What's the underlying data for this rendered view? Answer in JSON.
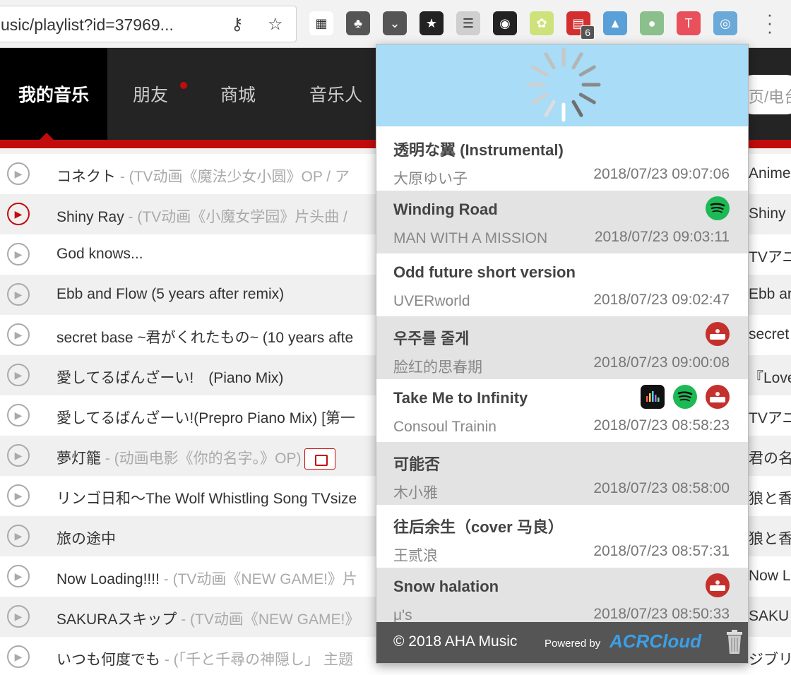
{
  "browser": {
    "url": "usic/playlist?id=37969...",
    "extensions": [
      {
        "name": "qr-code-icon",
        "color": "#ffffff"
      },
      {
        "name": "evernote-icon",
        "color": "#555555"
      },
      {
        "name": "pocket-icon",
        "color": "#555555"
      },
      {
        "name": "bookmark-star-icon",
        "color": "#222222"
      },
      {
        "name": "reader-icon",
        "color": "#cfcfcf"
      },
      {
        "name": "speedometer-icon",
        "color": "#222222"
      },
      {
        "name": "plant-icon",
        "color": "#cde27a"
      },
      {
        "name": "calendar-icon",
        "color": "#d32f2f",
        "badge": "6"
      },
      {
        "name": "stats-icon",
        "color": "#5aa0d8"
      },
      {
        "name": "circle-icon",
        "color": "#8bbf8b"
      },
      {
        "name": "tapermonkey-icon",
        "color": "#e8505b"
      },
      {
        "name": "aha-music-icon",
        "color": "#6aa9d8"
      }
    ]
  },
  "nav": {
    "items": [
      "我的音乐",
      "朋友",
      "商城",
      "音乐人"
    ],
    "search_placeholder": "页/电台"
  },
  "playlist": [
    {
      "title": "コネクト",
      "subtitle": " - (TV动画《魔法少女小圆》OP / ア",
      "right": "Anime",
      "active": false,
      "mv": false
    },
    {
      "title": "Shiny Ray",
      "subtitle": " - (TV动画《小魔女学园》片头曲 / ",
      "right": "Shiny",
      "active": true,
      "mv": false
    },
    {
      "title": "God knows...",
      "subtitle": "",
      "right": "TVアニ",
      "active": false,
      "mv": false
    },
    {
      "title": "Ebb and Flow (5 years after remix)",
      "subtitle": "",
      "right": "Ebb ar",
      "active": false,
      "mv": false
    },
    {
      "title": "secret base ~君がくれたもの~ (10 years afte",
      "subtitle": "",
      "right": "secret",
      "active": false,
      "mv": false
    },
    {
      "title": "愛してるばんざーい!　(Piano Mix)",
      "subtitle": "",
      "right": "『Love",
      "active": false,
      "mv": false
    },
    {
      "title": "愛してるばんざーい!(Prepro Piano Mix) [第一",
      "subtitle": "",
      "right": "TVアニ",
      "active": false,
      "mv": false
    },
    {
      "title": "夢灯籠",
      "subtitle": " - (动画电影《你的名字。》OP)",
      "right": "君の名",
      "active": false,
      "mv": true
    },
    {
      "title": "リンゴ日和～The Wolf Whistling Song TVsize",
      "subtitle": "",
      "right": "狼と香",
      "active": false,
      "mv": false
    },
    {
      "title": "旅の途中",
      "subtitle": "",
      "right": "狼と香",
      "active": false,
      "mv": false
    },
    {
      "title": "Now Loading!!!!",
      "subtitle": " - (TV动画《NEW GAME!》片",
      "right": "Now L",
      "active": false,
      "mv": false
    },
    {
      "title": "SAKURAスキップ",
      "subtitle": " - (TV动画《NEW GAME!》",
      "right": "SAKU",
      "active": false,
      "mv": false
    },
    {
      "title": "いつも何度でも",
      "subtitle": " - (「千と千尋の神隠し」 主题",
      "right": "ジブリ",
      "active": false,
      "mv": false
    }
  ],
  "popup": {
    "history": [
      {
        "title": "透明な翼 (Instrumental)",
        "artist": "大原ゆい子",
        "time": "2018/07/23 09:07:06",
        "services": []
      },
      {
        "title": "Winding Road",
        "artist": "MAN WITH A MISSION",
        "time": "2018/07/23 09:03:11",
        "services": [
          "spotify"
        ]
      },
      {
        "title": "Odd future short version",
        "artist": "UVERworld",
        "time": "2018/07/23 09:02:47",
        "services": []
      },
      {
        "title": "우주를 줄게",
        "artist": "脸红的思春期",
        "time": "2018/07/23 09:00:08",
        "services": [
          "youtube"
        ]
      },
      {
        "title": "Take Me to Infinity",
        "artist": "Consoul Trainin",
        "time": "2018/07/23 08:58:23",
        "services": [
          "applemusic",
          "spotify",
          "youtube"
        ]
      },
      {
        "title": "可能否",
        "artist": "木小雅",
        "time": "2018/07/23 08:58:00",
        "services": []
      },
      {
        "title": "往后余生（cover 马良）",
        "artist": "王贰浪",
        "time": "2018/07/23 08:57:31",
        "services": []
      },
      {
        "title": "Snow halation",
        "artist": "μ's",
        "time": "2018/07/23 08:50:33",
        "services": [
          "youtube"
        ]
      }
    ],
    "footer": {
      "copyright": "© 2018 AHA Music",
      "powered_by": "Powered by",
      "acr": "ACRCloud"
    }
  }
}
